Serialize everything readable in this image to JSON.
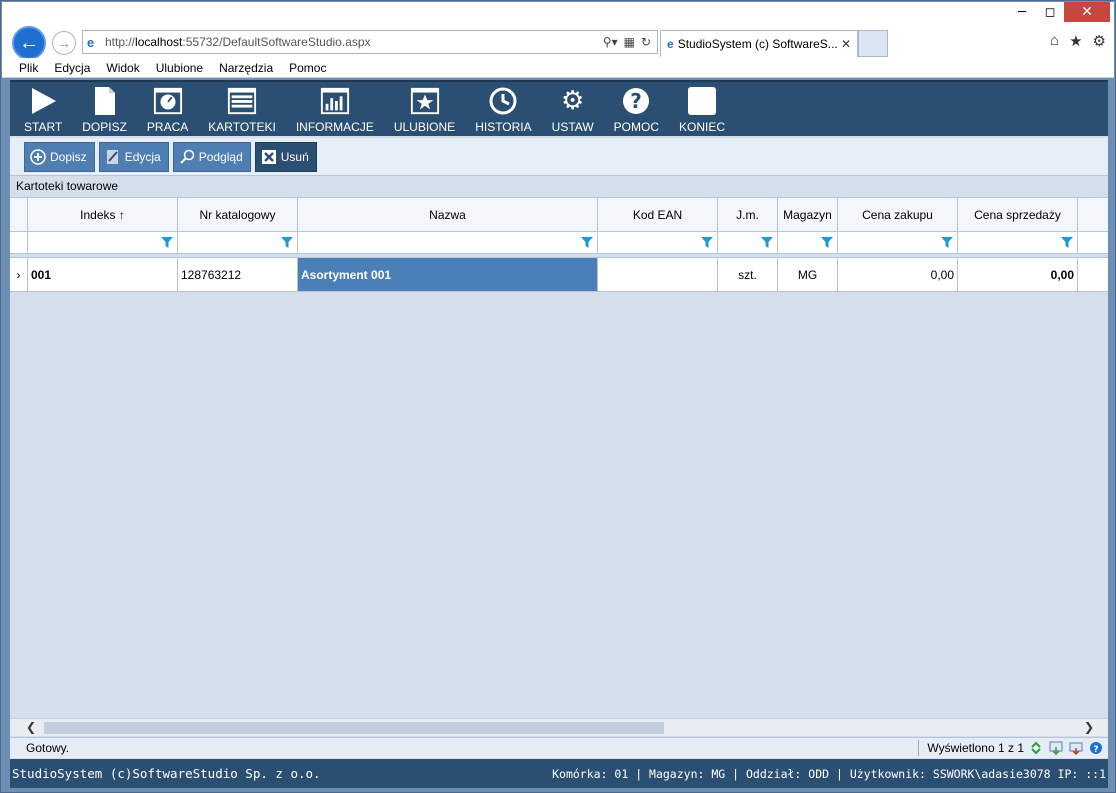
{
  "browser": {
    "url_prefix": "http://",
    "url_host": "localhost",
    "url_rest": ":55732/DefaultSoftwareStudio.aspx",
    "tab_title": "StudioSystem (c) SoftwareS...",
    "menu": [
      "Plik",
      "Edycja",
      "Widok",
      "Ulubione",
      "Narzędzia",
      "Pomoc"
    ]
  },
  "toolbar": [
    {
      "label": "START",
      "icon": "play-icon"
    },
    {
      "label": "DOPISZ",
      "icon": "document-icon"
    },
    {
      "label": "PRACA",
      "icon": "window-gauge-icon"
    },
    {
      "label": "KARTOTEKI",
      "icon": "window-list-icon"
    },
    {
      "label": "INFORMACJE",
      "icon": "bar-chart-icon"
    },
    {
      "label": "ULUBIONE",
      "icon": "star-window-icon"
    },
    {
      "label": "HISTORIA",
      "icon": "history-icon"
    },
    {
      "label": "USTAW",
      "icon": "gears-icon"
    },
    {
      "label": "POMOC",
      "icon": "help-icon"
    },
    {
      "label": "KONIEC",
      "icon": "exit-icon"
    }
  ],
  "actions": {
    "add": "Dopisz",
    "edit": "Edycja",
    "preview": "Podgląd",
    "delete": "Usuń"
  },
  "panel_title": "Kartoteki towarowe",
  "grid": {
    "columns": [
      "Indeks",
      "Nr katalogowy",
      "Nazwa",
      "Kod EAN",
      "J.m.",
      "Magazyn",
      "Cena zakupu",
      "Cena sprzedaży"
    ],
    "sort_indicator": "↑",
    "rows": [
      {
        "indeks": "001",
        "nr_katalogowy": "128763212",
        "nazwa": "Asortyment 001",
        "kod_ean": "",
        "jm": "szt.",
        "magazyn": "MG",
        "cena_zakupu": "0,00",
        "cena_sprzedazy": "0,00"
      }
    ]
  },
  "status": {
    "left": "Gotowy.",
    "count": "Wyświetlono 1 z 1"
  },
  "footer": {
    "left": "StudioSystem (c)SoftwareStudio Sp. z o.o.",
    "right": "Komórka: 01 | Magazyn: MG | Oddział: ODD | Użytkownik: SSWORK\\adasie3078 IP: ::1"
  },
  "colors": {
    "toolbar_bg": "#2b4f73",
    "button_bg": "#4f7fb2",
    "selection": "#4a80b7"
  }
}
